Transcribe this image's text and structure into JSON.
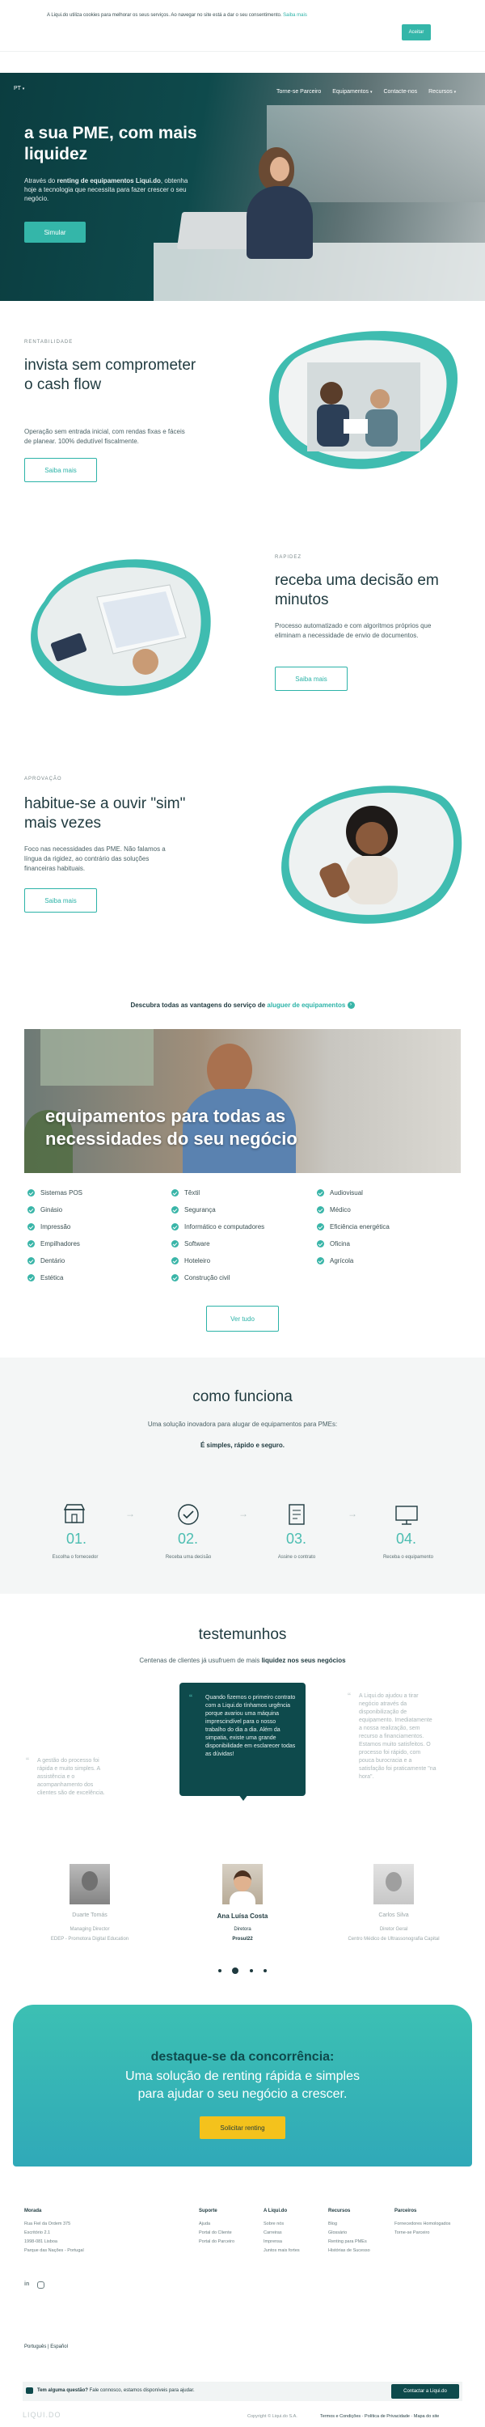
{
  "cookie": {
    "text": "A Liqui.do utiliza cookies para melhorar os seus serviços. Ao navegar no site está a dar o seu consentimento.",
    "link": "Saiba mais",
    "button": "Aceitar"
  },
  "nav": {
    "lang": "PT",
    "items": [
      "Torne-se Parceiro",
      "Equipamentos",
      "Contacte-nos",
      "Recursos"
    ]
  },
  "hero": {
    "title": "a sua PME, com mais liquidez",
    "text_pre": "Através do ",
    "text_bold": "renting de equipamentos Liqui.do",
    "text_post": ", obtenha hoje a tecnologia que necessita para fazer crescer o seu negócio.",
    "button": "Simular"
  },
  "features": [
    {
      "eyebrow": "RENTABILIDADE",
      "title": "invista sem comprometer o cash flow",
      "text": "Operação sem entrada inicial, com rendas fixas e fáceis de planear. 100% dedutível fiscalmente.",
      "button": "Saiba mais"
    },
    {
      "eyebrow": "RAPIDEZ",
      "title": "receba uma decisão em minutos",
      "text": "Processo automatizado e com algoritmos próprios que eliminam a necessidade de envio de documentos.",
      "button": "Saiba mais"
    },
    {
      "eyebrow": "APROVAÇÃO",
      "title": "habitue-se a ouvir \"sim\" mais vezes",
      "text": "Foco nas necessidades das PME. Não falamos a língua da rigidez, ao contrário das soluções financeiras habituais.",
      "button": "Saiba mais"
    }
  ],
  "advantages": {
    "text_pre": "Descubra todas as vantagens do serviço de ",
    "link": "aluguer de equipamentos"
  },
  "equipment": {
    "title": "equipamentos para todas as necessidades do seu negócio",
    "categories": [
      [
        "Sistemas POS",
        "Têxtil",
        "Audiovisual"
      ],
      [
        "Ginásio",
        "Segurança",
        "Médico"
      ],
      [
        "Impressão",
        "Informático e computadores",
        "Eficiência energética"
      ],
      [
        "Empilhadores",
        "Software",
        "Oficina"
      ],
      [
        "Dentário",
        "Hoteleiro",
        "Agrícola"
      ],
      [
        "Estética",
        "Construção civil",
        ""
      ]
    ],
    "button": "Ver tudo"
  },
  "how": {
    "title": "como funciona",
    "subtitle": "Uma solução inovadora para alugar de equipamentos para PMEs:",
    "tagline": "É simples, rápido e seguro.",
    "steps": [
      {
        "num": "01.",
        "label": "Escolha o fornecedor"
      },
      {
        "num": "02.",
        "label": "Receba uma decisão"
      },
      {
        "num": "03.",
        "label": "Assine o contrato"
      },
      {
        "num": "04.",
        "label": "Receba o equipamento"
      }
    ]
  },
  "testimonials": {
    "title": "testemunhos",
    "subtitle_pre": "Centenas de clientes já usufruem de mais ",
    "subtitle_bold": "liquidez nos seus negócios",
    "left_quote": "A gestão do processo foi rápida e muito simples. A assistência e o acompanhamento dos clientes são de excelência.",
    "center_quote": "Quando fizemos o primeiro contrato com a Liqui.do tínhamos urgência porque avariou uma máquina imprescindível para o nosso trabalho do dia a dia. Além da simpatia, existe uma grande disponibilidade em esclarecer todas as dúvidas!",
    "right_quote": "A Liqui.do ajudou a tirar negócio através da disponibilização de equipamento. Imediatamente a nossa realização, sem recurso a financiamentos. Estamos muito satisfeitos. O processo foi rápido, com pouca burocracia e a satisfação foi praticamente \"na hora\".",
    "people": [
      {
        "name": "Duarte Tomás",
        "role": "Managing Director",
        "company": "EDEP - Promotora Digital Education"
      },
      {
        "name": "Ana Luísa Costa",
        "role": "Diretora",
        "company": "Prosul22"
      },
      {
        "name": "Carlos Silva",
        "role": "Diretor Geral",
        "company": "Centro Médico de Ultrassonografia Capital"
      }
    ]
  },
  "cta": {
    "title": "destaque-se da concorrência:",
    "line1": "Uma solução de renting rápida e simples",
    "line2": "para ajudar o seu negócio a crescer.",
    "button": "Solicitar renting"
  },
  "footer": {
    "moradas": {
      "title": "Morada",
      "lines": [
        "Rua Fiel da Ordem 375",
        "Escritório 2.1",
        "1998-081 Lisboa",
        "Parque das Nações - Portugal"
      ]
    },
    "suporte": {
      "title": "Suporte",
      "lines": [
        "Ajuda",
        "Portal do Cliente",
        "Portal do Parceiro"
      ]
    },
    "liquido": {
      "title": "A Liqui.do",
      "lines": [
        "Sobre nós",
        "Carreiras",
        "Imprensa",
        "Juntos mais fortes"
      ]
    },
    "recursos": {
      "title": "Recursos",
      "lines": [
        "Blog",
        "Glossário",
        "Renting para PMEs",
        "Histórias de Sucesso"
      ]
    },
    "parceiros": {
      "title": "Parceiros",
      "lines": [
        "Fornecedores Homologados",
        "Torne-se Parceiro"
      ]
    },
    "lang": "Português | Español"
  },
  "bottom_bar": {
    "question": "Tem alguma questão?",
    "question_text": " Fale connosco, estamos disponíveis para ajudar.",
    "button": "Contactar a Liqui.do"
  },
  "legal": {
    "logo": "LIQUI.DO",
    "copyright": "Copyright © Liqui.do S.A.",
    "links": "Termos e Condições · Política de Privacidade · Mapa do site"
  },
  "colors": {
    "brand": "#34b6a9",
    "dark_teal": "#0e4a4c",
    "cta_yellow": "#f4c21c"
  }
}
